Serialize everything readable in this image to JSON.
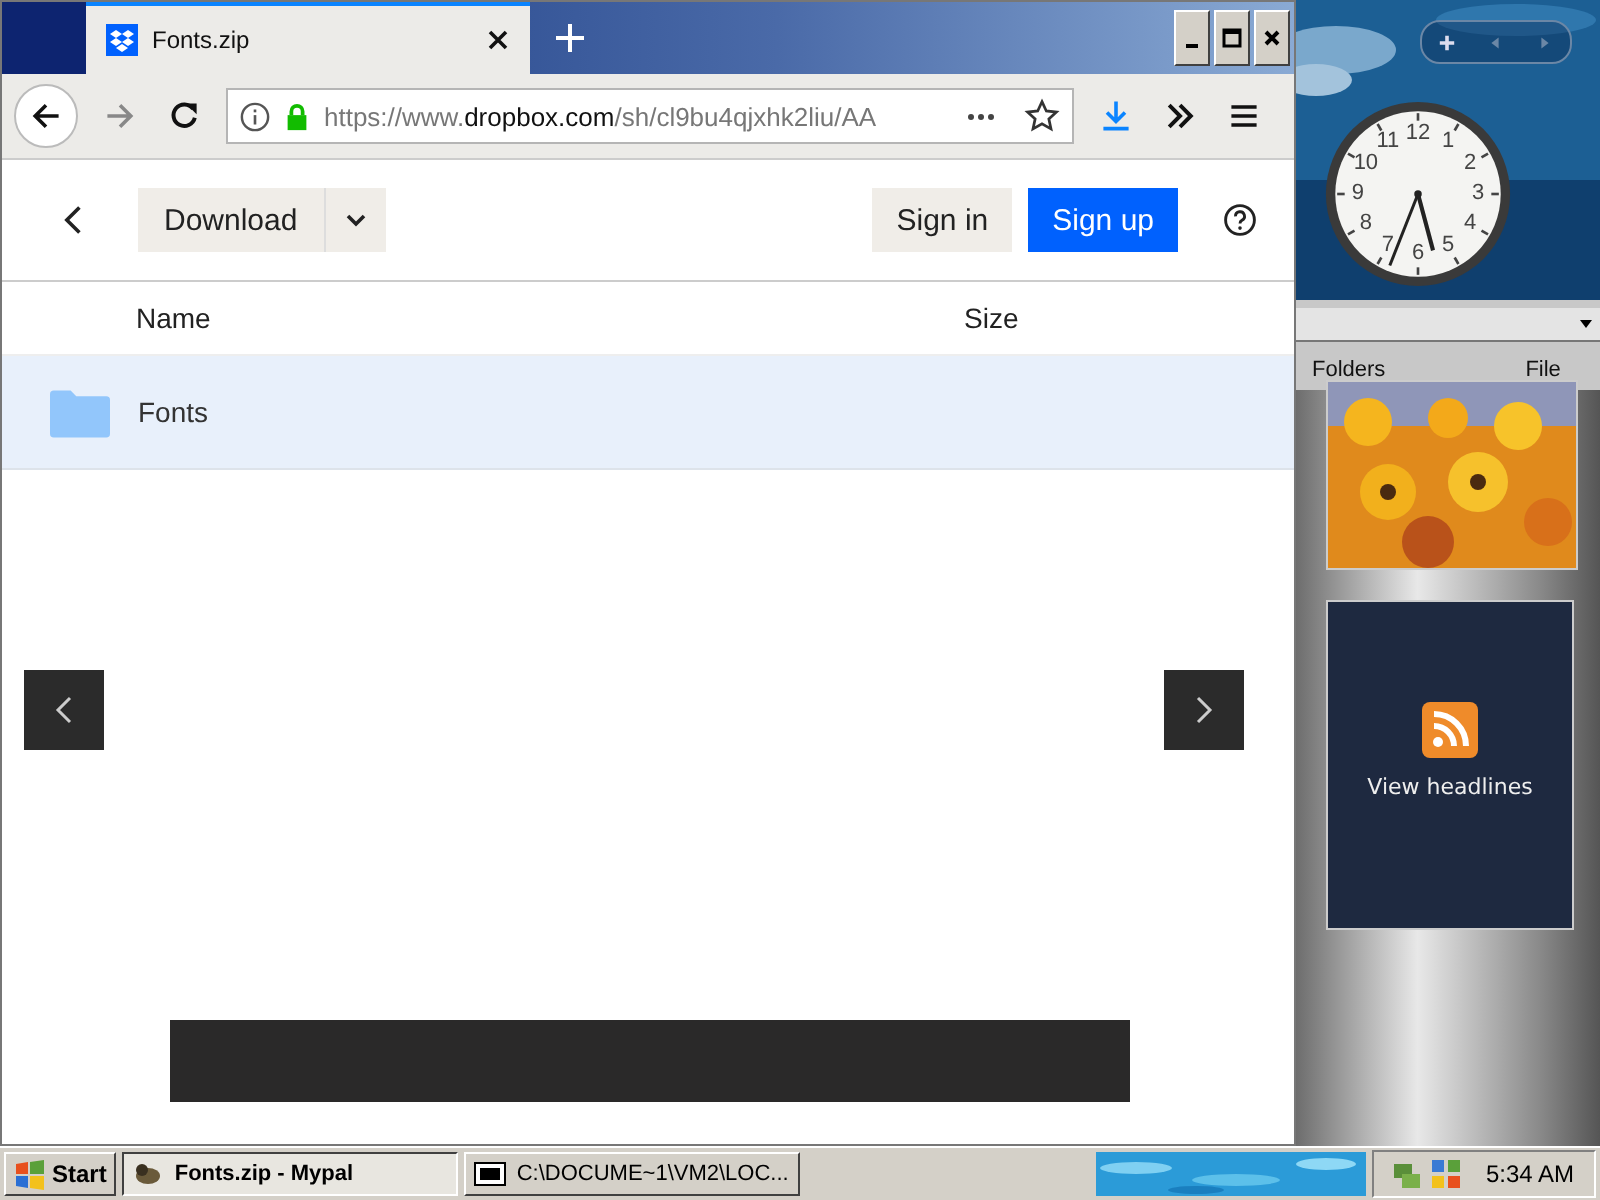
{
  "browser": {
    "tabs": [
      {
        "title": "Fonts.zip",
        "selected": true
      }
    ],
    "address": {
      "scheme": "https://www.",
      "domain": "dropbox.com",
      "path": "/sh/cl9bu4qjxhk2liu/AA"
    }
  },
  "page": {
    "download_label": "Download",
    "sign_in": "Sign in",
    "sign_up": "Sign up",
    "columns": [
      "Name",
      "Size"
    ],
    "rows": [
      {
        "name": "Fonts",
        "selected": true
      }
    ]
  },
  "gadgets": {
    "clock": {
      "numerals": [
        "12",
        "11",
        "1",
        "10",
        "2",
        "9",
        "3",
        "8",
        "4",
        "7",
        "5",
        "6"
      ]
    },
    "feed": {
      "label": "View headlines"
    },
    "background_window": {
      "tabs": [
        "Folders",
        "File"
      ]
    }
  },
  "taskbar": {
    "start": "Start",
    "tasks": [
      {
        "label": "Fonts.zip - Mypal",
        "selected": true
      },
      {
        "label": "C:\\DOCUME~1\\VM2\\LOC...",
        "selected": false
      }
    ],
    "time": "5:34 AM"
  }
}
